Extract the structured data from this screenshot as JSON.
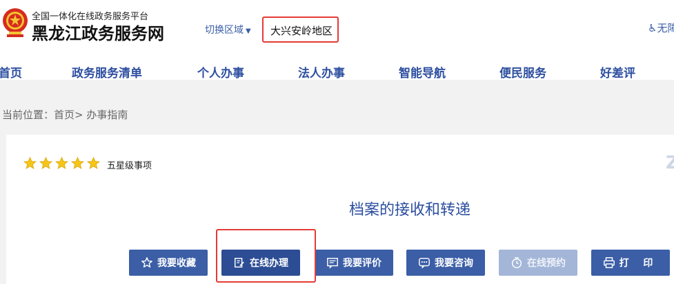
{
  "header": {
    "site_subtitle": "全国一体化在线政务服务平台",
    "site_title": "黑龙江政务服务网",
    "region_switch_label": "切换区域",
    "current_region": "大兴安岭地区",
    "accessibility_label": "无障"
  },
  "nav": {
    "items": [
      {
        "label": "首页"
      },
      {
        "label": "政务服务清单"
      },
      {
        "label": "个人办事"
      },
      {
        "label": "法人办事"
      },
      {
        "label": "智能导航"
      },
      {
        "label": "便民服务"
      },
      {
        "label": "好差评"
      }
    ]
  },
  "breadcrumb": {
    "prefix": "当前位置：",
    "home": "首页",
    "separator": ">",
    "current": "办事指南"
  },
  "item": {
    "star_count": 5,
    "star_level_label": "五星级事项",
    "title": "档案的接收和转递"
  },
  "actions": {
    "favorite": "我要收藏",
    "online": "在线办理",
    "evaluate": "我要评价",
    "consult": "我要咨询",
    "appointment": "在线预约",
    "print": "打 印"
  },
  "colors": {
    "brand_blue": "#3b5ea6",
    "nav_text": "#2d4fa0",
    "highlight_red": "#e53935",
    "star_gold": "#f5c518",
    "disabled_button": "#a4b6d8"
  }
}
